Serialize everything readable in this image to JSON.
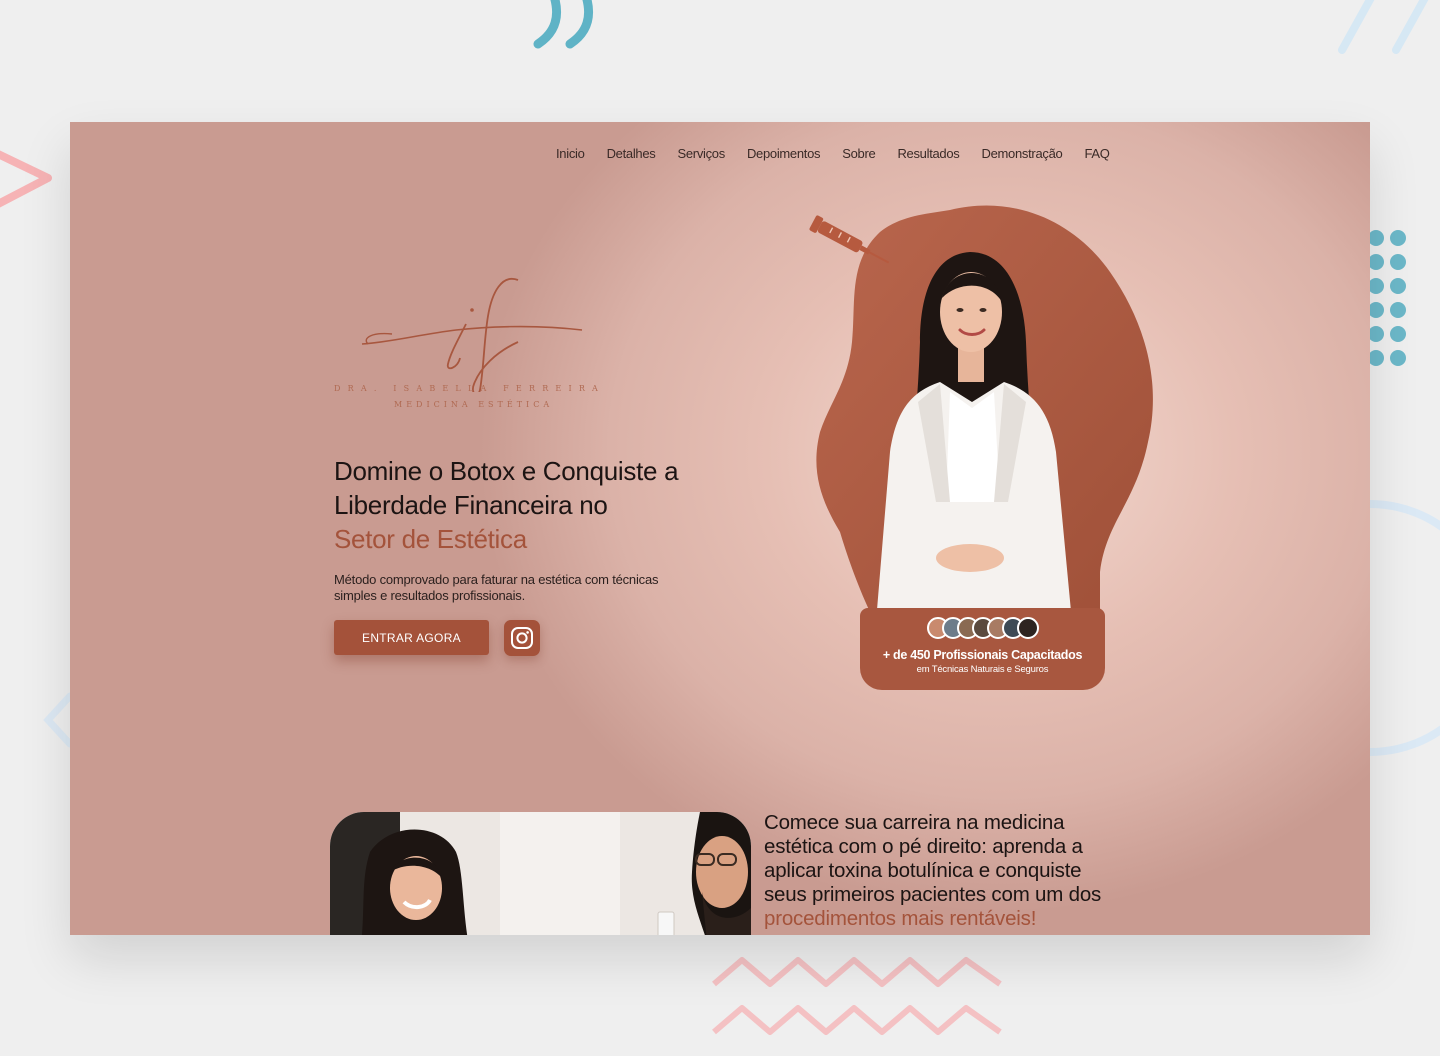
{
  "nav": {
    "items": [
      "Inicio",
      "Detalhes",
      "Serviços",
      "Depoimentos",
      "Sobre",
      "Resultados",
      "Demonstração",
      "FAQ"
    ]
  },
  "logo": {
    "monogram": "if",
    "name": "DRA. ISABELLA FERREIRA",
    "subtitle": "MEDICINA ESTÉTICA"
  },
  "hero": {
    "title_line1": "Domine o Botox e Conquiste",
    "title_line2": "a Liberdade Financeira no",
    "title_accent": "Setor de Estética",
    "subtitle": "Método comprovado para faturar na estética com técnicas simples e resultados profissionais.",
    "cta_label": "ENTRAR AGORA",
    "social_icon": "instagram-icon"
  },
  "badge": {
    "title": "+ de 450  Profissionais Capacitados",
    "subtitle": "em Técnicas Naturais e Seguros",
    "avatar_count": 7
  },
  "section2": {
    "text": "Comece sua carreira na medicina estética com o pé direito: aprenda a aplicar toxina botulínica e conquiste seus primeiros pacientes com um dos ",
    "accent": "procedimentos mais rentáveis!"
  },
  "colors": {
    "background": "#efefef",
    "frame": "#dbb2a8",
    "accent": "#a4533b",
    "text": "#1c1413",
    "deco_blue": "#6cb8c9",
    "deco_pink": "#f4a9ad"
  }
}
